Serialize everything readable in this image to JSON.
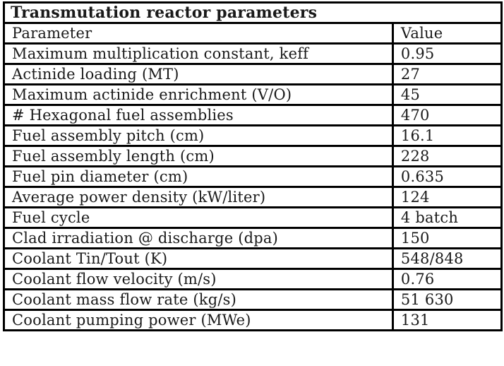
{
  "table": {
    "title": "Transmutation reactor parameters",
    "headers": [
      "Parameter",
      "Value"
    ],
    "rows": [
      {
        "parameter": "Maximum multiplication constant, keff",
        "value": "0.95"
      },
      {
        "parameter": "Actinide loading (MT)",
        "value": "27"
      },
      {
        "parameter": "Maximum actinide enrichment (V/O)",
        "value": "45"
      },
      {
        "parameter": "# Hexagonal fuel assemblies",
        "value": "470"
      },
      {
        "parameter": "Fuel assembly pitch (cm)",
        "value": "16.1"
      },
      {
        "parameter": "Fuel assembly length (cm)",
        "value": "228"
      },
      {
        "parameter": "Fuel pin diameter (cm)",
        "value": "0.635"
      },
      {
        "parameter": "Average power density (kW/liter)",
        "value": "124"
      },
      {
        "parameter": "Fuel cycle",
        "value": "4 batch"
      },
      {
        "parameter": "Clad irradiation @ discharge (dpa)",
        "value": "150"
      },
      {
        "parameter": "Coolant Tin/Tout (K)",
        "value": "548/848"
      },
      {
        "parameter": "Coolant flow velocity (m/s)",
        "value": "0.76"
      },
      {
        "parameter": "Coolant mass flow rate (kg/s)",
        "value": "51 630"
      },
      {
        "parameter": "Coolant pumping power (MWe)",
        "value": "131"
      }
    ]
  }
}
